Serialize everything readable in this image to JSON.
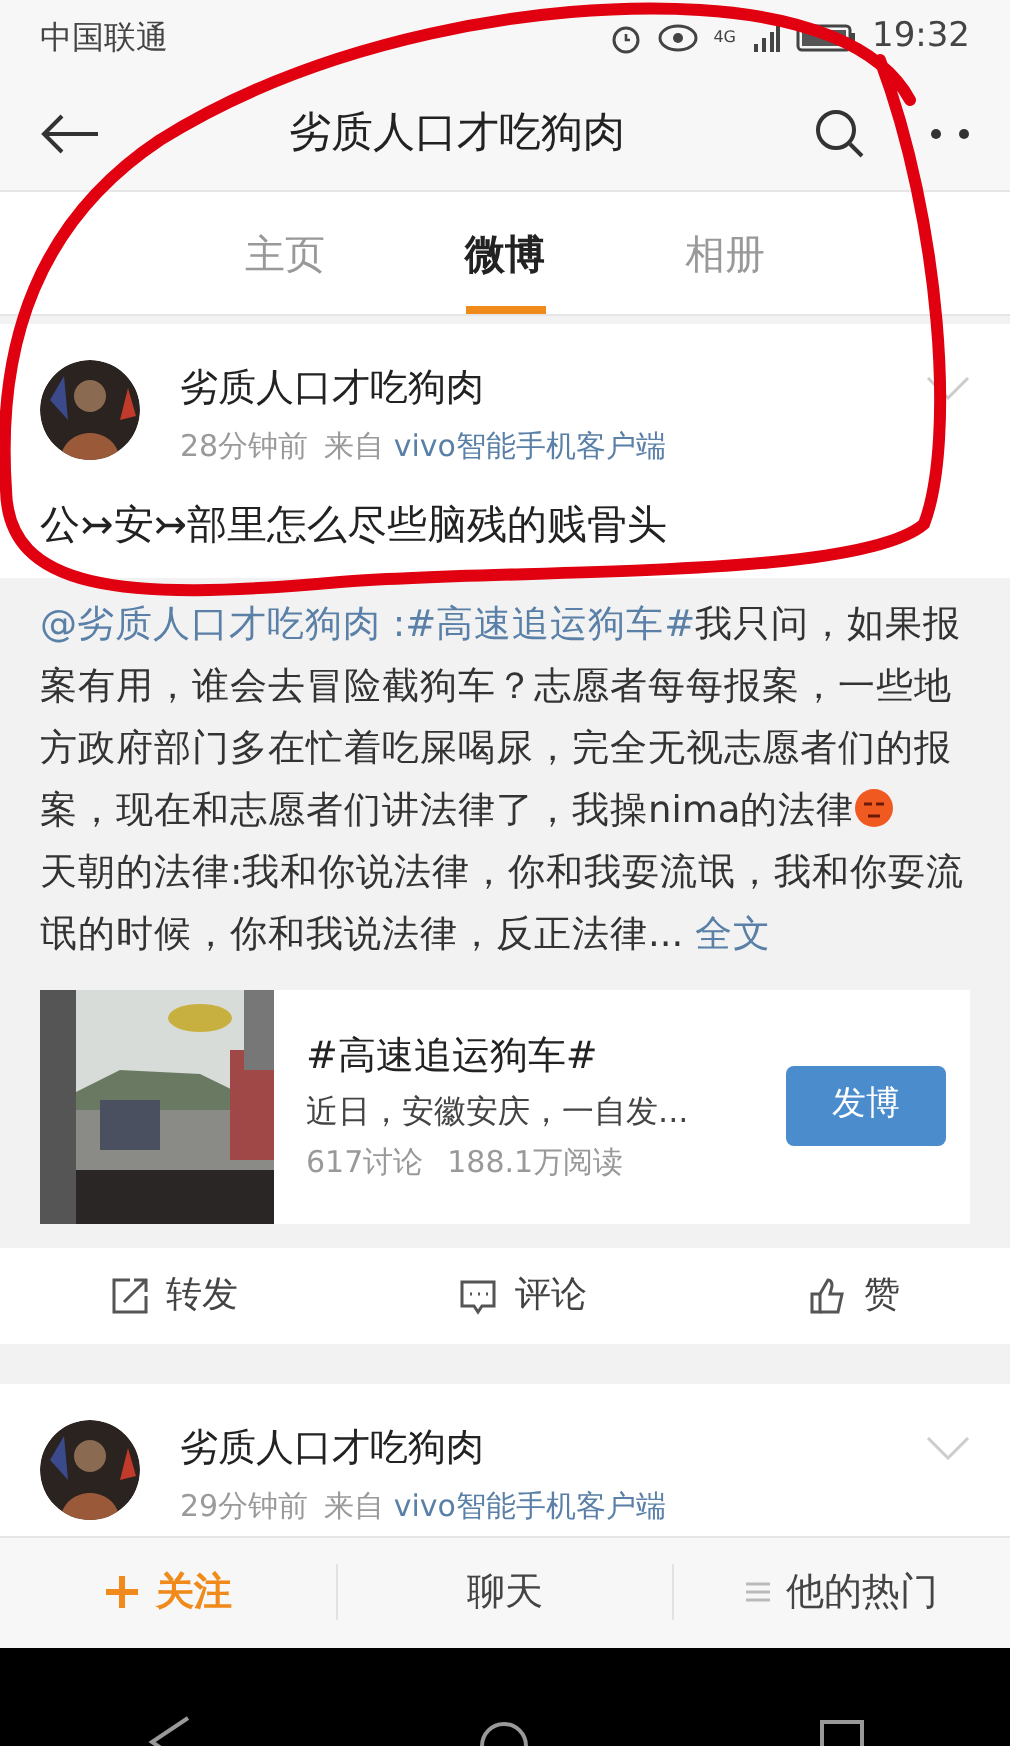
{
  "status_bar": {
    "carrier": "中国联通",
    "network": "4G",
    "time": "19:32"
  },
  "header": {
    "title": "劣质人口才吃狗肉"
  },
  "tabs": [
    {
      "label": "主页",
      "selected": false
    },
    {
      "label": "微博",
      "selected": true
    },
    {
      "label": "相册",
      "selected": false
    }
  ],
  "posts": [
    {
      "author": "劣质人口才吃狗肉",
      "time": "28分钟前",
      "source_prefix": "来自",
      "source": "vivo智能手机客户端",
      "text": "公↣安↣部里怎么尽些脑残的贱骨头",
      "repost": {
        "mention": "@劣质人口才吃狗肉 :",
        "hashtag": "#高速追运狗车#",
        "body": "我只问，如果报案有用，谁会去冒险截狗车？志愿者每每报案，一些地方政府部门多在忙着吃屎喝尿，完全无视志愿者们的报案，现在和志愿者们讲法律了，我操nima的法律",
        "body_2": "天朝的法律:我和你说法律，你和我耍流氓，我和你耍流氓的时候，你和我说法律，反正法律...",
        "more": "全文",
        "topic_card": {
          "title": "#高速追运狗车#",
          "summary": "近日，安徽安庆，一自发...",
          "discussions": "617讨论",
          "reads": "188.1万阅读",
          "button": "发博"
        }
      },
      "actions": [
        {
          "kind": "repost",
          "label": "转发"
        },
        {
          "kind": "comment",
          "label": "评论"
        },
        {
          "kind": "like",
          "label": "赞"
        }
      ]
    },
    {
      "author": "劣质人口才吃狗肉",
      "time": "29分钟前",
      "source_prefix": "来自",
      "source": "vivo智能手机客户端"
    }
  ],
  "bottom_bar": [
    {
      "kind": "follow",
      "label": "关注"
    },
    {
      "kind": "chat",
      "label": "聊天"
    },
    {
      "kind": "hot",
      "label": "他的热门"
    }
  ]
}
